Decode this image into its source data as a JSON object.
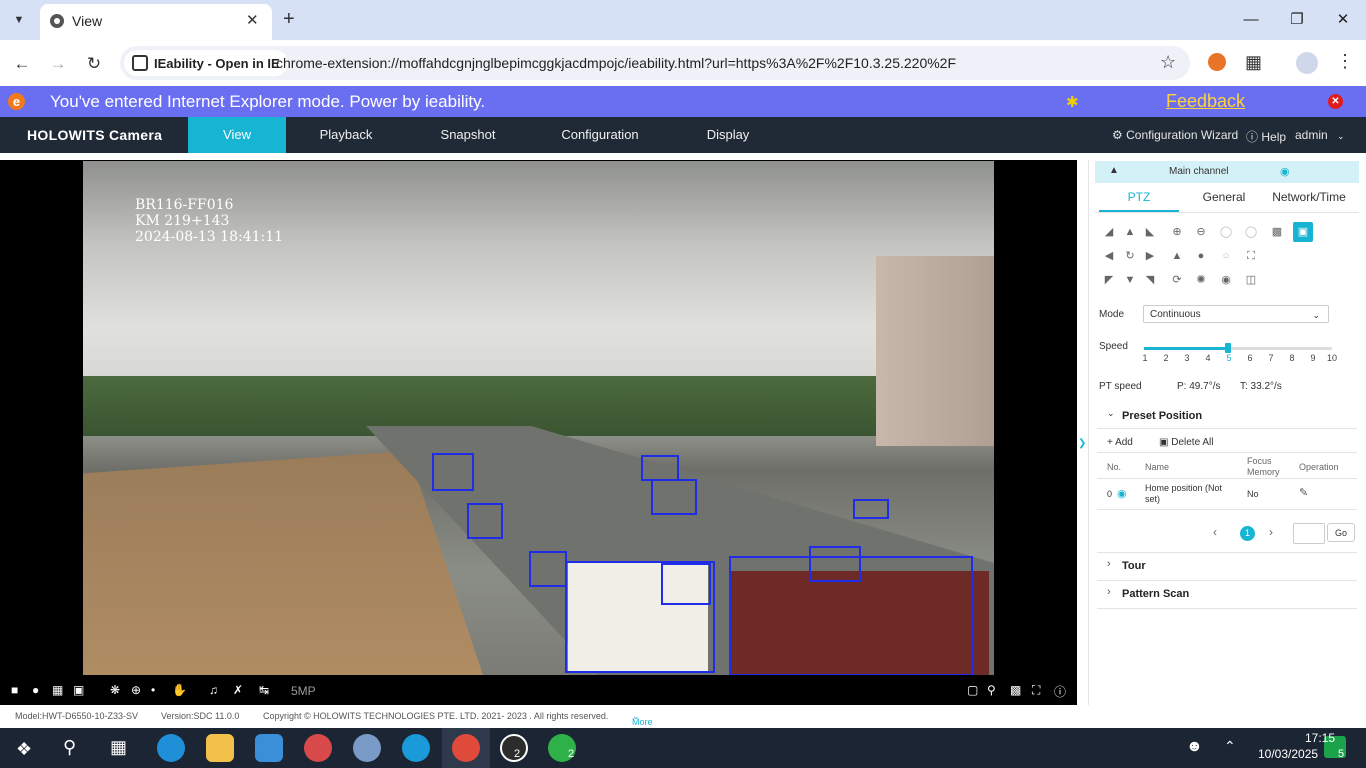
{
  "browser": {
    "tab_title": "View",
    "tab_list_icon": "chevron-down-icon",
    "new_tab_icon": "plus-icon",
    "omnibox": {
      "extension_chip": "IEability - Open in IE",
      "url": "chrome-extension://moffahdcgnjnglbepimcggkjacdmpojc/ieability.html?url=https%3A%2F%2F10.3.25.220%2F"
    }
  },
  "ie_banner": {
    "message": "You've entered Internet Explorer mode. Power by ieability.",
    "feedback": "Feedback",
    "bg_color": "#6a6ff2"
  },
  "app": {
    "brand": "HOLOWITS Camera",
    "nav_tabs": [
      "View",
      "Playback",
      "Snapshot",
      "Configuration",
      "Display"
    ],
    "active_tab": "View",
    "accent_color": "#17b4d4",
    "wizard": "Configuration Wizard",
    "help": "Help",
    "user": "admin"
  },
  "video": {
    "osd_line1": "BR116-FF016",
    "osd_line2": "KM 219+143",
    "osd_line3": "2024-08-13 18:41:11",
    "resolution": "5MP"
  },
  "footer": {
    "model": "Model:HWT-D6550-10-Z33-SV",
    "version": "Version:SDC 11.0.0",
    "copyright": "Copyright © HOLOWITS TECHNOLOGIES PTE. LTD. 2021- 2023 . All rights reserved.",
    "more": "More"
  },
  "panel": {
    "channel": "Main channel",
    "tabs": [
      "PTZ",
      "General",
      "Network/Time"
    ],
    "mode_label": "Mode",
    "mode_value": "Continuous",
    "speed_label": "Speed",
    "speed_ticks": [
      "1",
      "2",
      "3",
      "4",
      "5",
      "6",
      "7",
      "8",
      "9",
      "10"
    ],
    "speed_value": 5,
    "pt_speed_label": "PT speed",
    "pt_speed_p": "P: 49.7°/s",
    "pt_speed_t": "T: 33.2°/s",
    "preset_title": "Preset Position",
    "add": "Add",
    "delete_all": "Delete All",
    "table_headers": [
      "No.",
      "Name",
      "Focus Memory",
      "Operation"
    ],
    "presets": [
      {
        "no": "0",
        "name": "Home position (Not set)",
        "focus_memory": "No"
      }
    ],
    "page": "1",
    "go": "Go",
    "tour": "Tour",
    "pattern_scan": "Pattern Scan"
  },
  "taskbar": {
    "time": "17:15",
    "date": "10/03/2025",
    "badge_whatsapp_web": "2",
    "badge_whatsapp": "2",
    "badge_notifications": "5"
  }
}
